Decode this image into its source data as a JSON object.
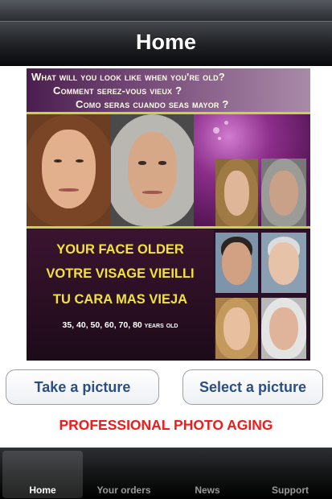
{
  "nav": {
    "title": "Home"
  },
  "banner": {
    "question_en": "What will you look like when you're old?",
    "question_fr": "Comment serez-vous vieux ?",
    "question_es": "Como seras cuando seas mayor ?",
    "slogan_en": "YOUR FACE OLDER",
    "slogan_fr": "VOTRE VISAGE VIEILLI",
    "slogan_es": "TU CARA MAS VIEJA",
    "ages": "35, 40, 50, 60, 70, 80 years old"
  },
  "buttons": {
    "take": "Take a picture",
    "select": "Select a picture"
  },
  "tagline": "PROFESSIONAL PHOTO AGING",
  "tabs": [
    {
      "label": "Home",
      "active": true
    },
    {
      "label": "Your orders",
      "active": false
    },
    {
      "label": "News",
      "active": false
    },
    {
      "label": "Support",
      "active": false
    }
  ],
  "colors": {
    "accent": "#2a4f86",
    "tagline": "#ee1c1c",
    "slogan": "#f3e23a",
    "highlight_line": "#c9d34a"
  }
}
